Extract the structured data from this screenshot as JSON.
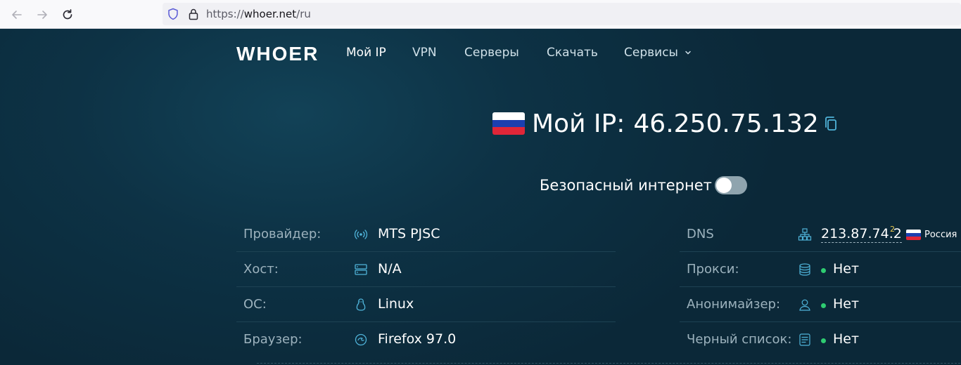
{
  "browser": {
    "url_scheme": "https://",
    "url_domain": "whoer.net",
    "url_path": "/ru",
    "icons": [
      "back-arrow-icon",
      "forward-arrow-icon",
      "reload-icon",
      "shield-icon",
      "lock-icon"
    ]
  },
  "site": {
    "logo": "WHOER",
    "nav": {
      "my_ip": "Мой IP",
      "vpn": "VPN",
      "servers": "Серверы",
      "download": "Скачать",
      "services": "Сервисы"
    }
  },
  "ip": {
    "title": "Мой IP:",
    "address": "46.250.75.132",
    "flag_colors": [
      "#ffffff",
      "#1c3fb0",
      "#e02638"
    ]
  },
  "safe_internet": {
    "label": "Безопасный интернет",
    "enabled": false
  },
  "left_info": [
    {
      "label": "Провайдер:",
      "value": "MTS PJSC",
      "icon": "antenna-icon"
    },
    {
      "label": "Хост:",
      "value": "N/A",
      "icon": "server-icon"
    },
    {
      "label": "ОС:",
      "value": "Linux",
      "icon": "linux-penguin-icon"
    },
    {
      "label": "Браузер:",
      "value": "Firefox 97.0",
      "icon": "browser-icon"
    }
  ],
  "right_info": [
    {
      "label": "DNS",
      "value": "213.87.74.2",
      "superscript": "2",
      "country": "Россия",
      "icon": "network-icon"
    },
    {
      "label": "Прокси:",
      "value": "Нет",
      "icon": "database-icon"
    },
    {
      "label": "Анонимайзер:",
      "value": "Нет",
      "icon": "user-icon"
    },
    {
      "label": "Черный список:",
      "value": "Нет",
      "icon": "list-icon"
    }
  ],
  "colors": {
    "accent": "#4fb3d9",
    "ok": "#2ecc71",
    "background": "#0c2b3b"
  }
}
